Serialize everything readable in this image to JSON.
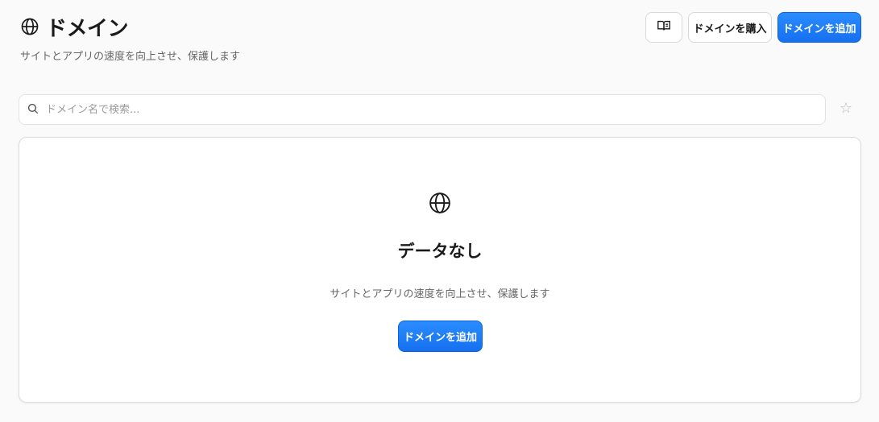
{
  "header": {
    "title": "ドメイン",
    "subtitle": "サイトとアプリの速度を向上させ、保護します",
    "title_icon": "globe-icon"
  },
  "actions": {
    "docs_icon": "book-open-icon",
    "buy_label": "ドメインを購入",
    "add_label": "ドメインを追加"
  },
  "search": {
    "placeholder": "ドメイン名で検索...",
    "value": "",
    "icon": "search-icon",
    "favorite_icon": "star-icon",
    "favorite_glyph": "☆"
  },
  "empty_state": {
    "icon": "globe-icon",
    "title": "データなし",
    "description": "サイトとアプリの速度を向上させ、保護します",
    "button_label": "ドメインを追加"
  },
  "colors": {
    "primary": "#1e7bf7",
    "background": "#fafafa",
    "text": "#1a1a1a",
    "muted": "#666666"
  }
}
